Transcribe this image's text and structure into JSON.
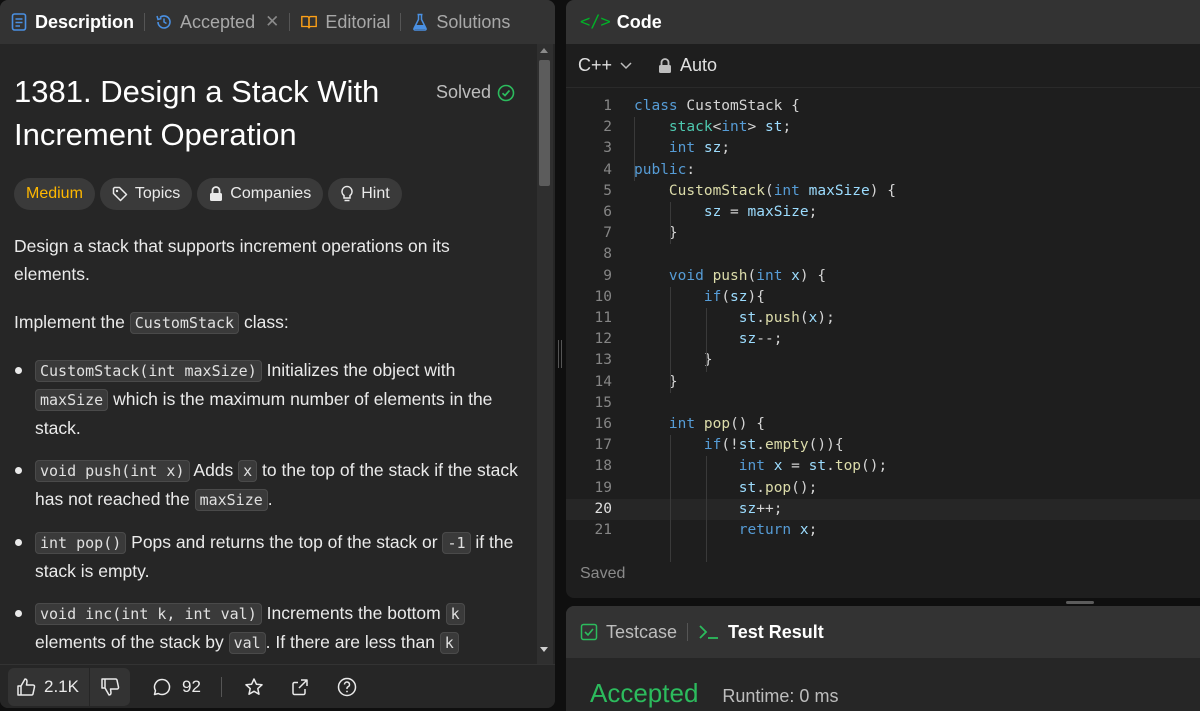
{
  "tabs": [
    {
      "label": "Description",
      "icon": "description-icon",
      "active": true
    },
    {
      "label": "Accepted",
      "icon": "history-icon",
      "closable": true
    },
    {
      "label": "Editorial",
      "icon": "book-icon"
    },
    {
      "label": "Solutions",
      "icon": "flask-icon"
    }
  ],
  "problem": {
    "title": "1381. Design a Stack With Increment Operation",
    "status": "Solved",
    "difficulty": "Medium",
    "tags": [
      "Topics",
      "Companies",
      "Hint"
    ],
    "intro": "Design a stack that supports increment operations on its elements.",
    "implement_prefix": "Implement the ",
    "implement_code": "CustomStack",
    "implement_suffix": " class:",
    "bullets": [
      {
        "code1": "CustomStack(int maxSize)",
        "text1": " Initializes the object with ",
        "code2": "maxSize",
        "text2": " which is the maximum number of elements in the stack."
      },
      {
        "code1": "void push(int x)",
        "text1": " Adds ",
        "code2": "x",
        "text2": " to the top of the stack if the stack has not reached the ",
        "code3": "maxSize",
        "text3": "."
      },
      {
        "code1": "int pop()",
        "text1": " Pops and returns the top of the stack or ",
        "code2": "-1",
        "text2": " if the stack is empty."
      },
      {
        "code1": "void inc(int k, int val)",
        "text1": " Increments the bottom ",
        "code2": "k",
        "text2": " elements of the stack by ",
        "code3": "val",
        "text3": ". If there are less than ",
        "code4": "k"
      }
    ]
  },
  "footer": {
    "likes": "2.1K",
    "comments": "92"
  },
  "code_panel": {
    "title": "Code",
    "language": "C++",
    "mode": "Auto",
    "saved_label": "Saved",
    "current_line": 20,
    "lines": [
      "class CustomStack {",
      "    stack<int> st;",
      "    int sz;",
      "public:",
      "    CustomStack(int maxSize) {",
      "        sz = maxSize;",
      "    }",
      "",
      "    void push(int x) {",
      "        if(sz){",
      "            st.push(x);",
      "            sz--;",
      "        }",
      "    }",
      "",
      "    int pop() {",
      "        if(!st.empty()){",
      "            int x = st.top();",
      "            st.pop();",
      "            sz++;",
      "            return x;"
    ]
  },
  "result_panel": {
    "tab_testcase": "Testcase",
    "tab_result": "Test Result",
    "verdict": "Accepted",
    "runtime": "Runtime: 0 ms"
  },
  "colors": {
    "accent_green": "#2cbb5d",
    "medium": "#ffb800",
    "keyword": "#569cd6",
    "function": "#dcdcaa"
  }
}
